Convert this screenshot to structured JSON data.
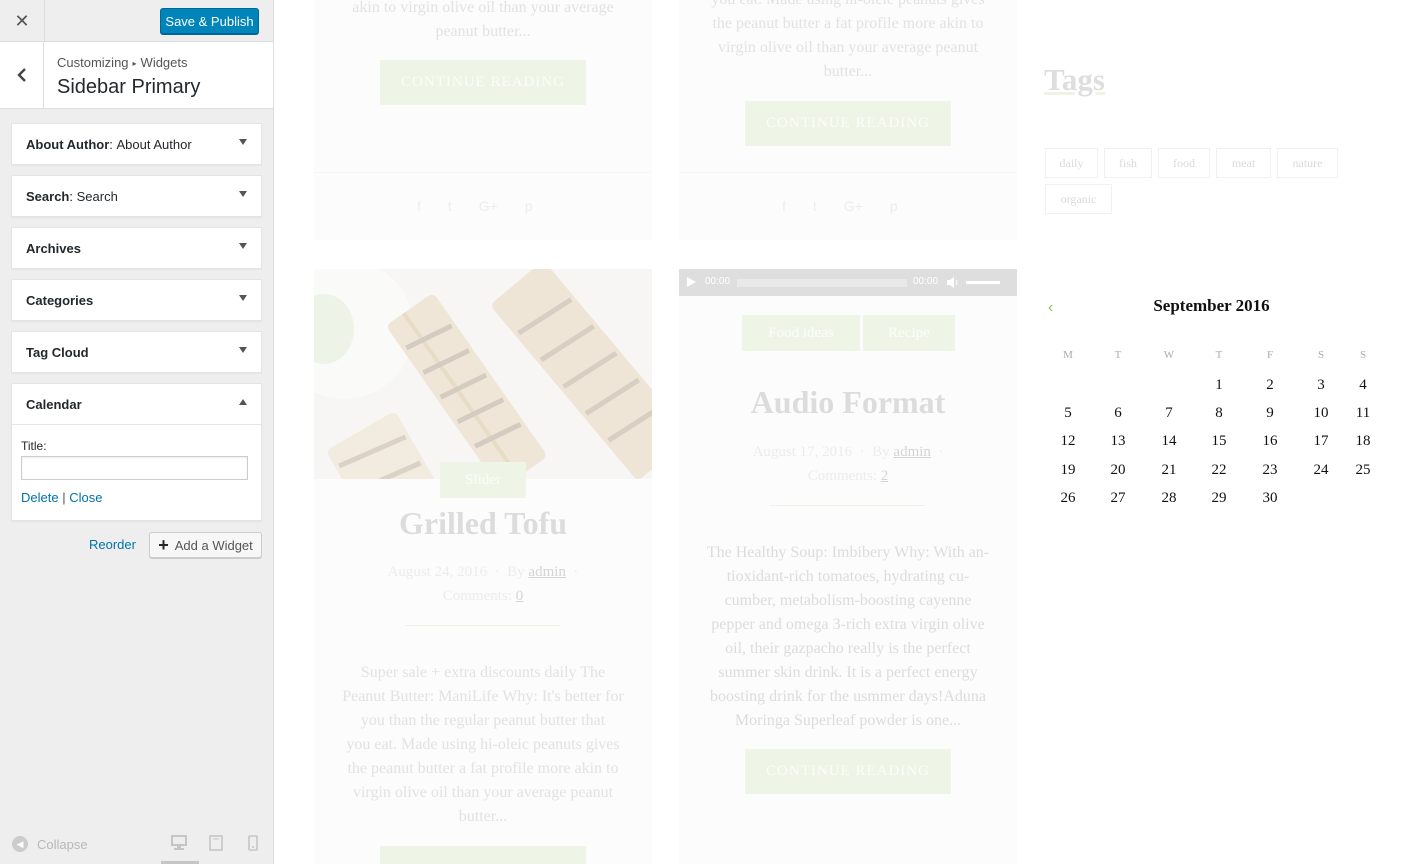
{
  "customizer": {
    "save_label": "Save & Publish",
    "breadcrumb_root": "Customizing",
    "breadcrumb_sep": "▸",
    "breadcrumb_child": "Widgets",
    "section_title": "Sidebar Primary",
    "widgets": [
      {
        "type": "About Author",
        "title": "About Author",
        "expanded": false
      },
      {
        "type": "Search",
        "title": "Search",
        "expanded": false
      },
      {
        "type": "Archives",
        "title": "",
        "expanded": false
      },
      {
        "type": "Categories",
        "title": "",
        "expanded": false
      },
      {
        "type": "Tag Cloud",
        "title": "",
        "expanded": false
      },
      {
        "type": "Calendar",
        "title": "",
        "expanded": true
      }
    ],
    "calendar_form": {
      "title_label": "Title:",
      "title_value": "",
      "delete_label": "Delete",
      "link_sep": "|",
      "close_label": "Close"
    },
    "reorder_label": "Reorder",
    "add_widget_label": "Add a Widget",
    "collapse_label": "Collapse"
  },
  "preview": {
    "post1_excerpt_tail": [
      "akin to virgin olive oil than your average",
      "peanut butter..."
    ],
    "post2_excerpt_tail": [
      "you eat. Made using hi-oleic peanuts gives",
      "the peanut butter a fat profile more akin to",
      "virgin olive oil than your average peanut",
      "butter..."
    ],
    "continue_label": "CONTINUE READING",
    "social_icons": [
      "f",
      "t",
      "G+",
      "p"
    ],
    "tofu_post": {
      "category": "Slider",
      "title": "Grilled Tofu",
      "date": "August 24, 2016",
      "by": "By",
      "author": "admin",
      "comments_label": "Comments:",
      "comments_count": "0",
      "excerpt": [
        "Super sale + extra discounts daily The",
        "Peanut Butter: ManiLife Why: It's better for",
        "you than the regular peanut butter that",
        "you eat. Made using hi-oleic peanuts gives",
        "the peanut butter a fat profile more akin to",
        "virgin olive oil than your average peanut",
        "butter..."
      ]
    },
    "audio_post": {
      "player_time_current": "00:00",
      "player_time_total": "00:00",
      "categories": [
        "Food ideas",
        "Recipe"
      ],
      "title": "Audio Format",
      "date": "August 17, 2016",
      "by": "By",
      "author": "admin",
      "comments_label": "Comments:",
      "comments_count": "2",
      "excerpt": [
        "The Healthy Soup: Imbibery Why: With an-",
        "tioxidant-rich tomatoes, hydrating cu-",
        "cumber, metabolism-boosting cayenne",
        "pepper and omega 3-rich extra virgin olive",
        "oil, their gazpacho really is the perfect",
        "summer skin drink. It is a perfect energy",
        "boosting drink for the usmmer days!Aduna",
        "Moringa Superleaf powder is one..."
      ]
    },
    "tags_title": "Tags",
    "tags": [
      "daily",
      "fish",
      "food",
      "meat",
      "nature",
      "organic"
    ],
    "calendar": {
      "prev_icon": "‹",
      "month": "September 2016",
      "dow": [
        "M",
        "T",
        "W",
        "T",
        "F",
        "S",
        "S"
      ],
      "weeks": [
        [
          "",
          "",
          "",
          "1",
          "2",
          "3",
          "4"
        ],
        [
          "5",
          "6",
          "7",
          "8",
          "9",
          "10",
          "11"
        ],
        [
          "12",
          "13",
          "14",
          "15",
          "16",
          "17",
          "18"
        ],
        [
          "19",
          "20",
          "21",
          "22",
          "23",
          "24",
          "25"
        ],
        [
          "26",
          "27",
          "28",
          "29",
          "30",
          "",
          ""
        ]
      ]
    }
  },
  "colors": {
    "publish_blue": "#0085ba",
    "link_blue": "#0073aa",
    "accent_green": "#8dc063"
  }
}
